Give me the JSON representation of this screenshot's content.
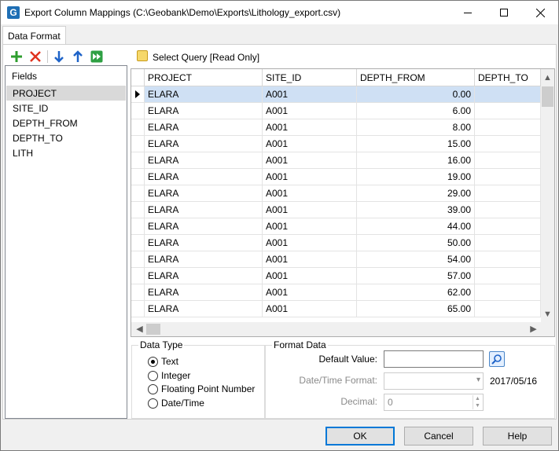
{
  "window": {
    "app_icon_letter": "G",
    "title": "Export Column Mappings (C:\\Geobank\\Demo\\Exports\\Lithology_export.csv)"
  },
  "tabs": [
    {
      "label": "Data Format"
    }
  ],
  "fields_panel": {
    "header": "Fields",
    "items": [
      "PROJECT",
      "SITE_ID",
      "DEPTH_FROM",
      "DEPTH_TO",
      "LITH"
    ],
    "selected": "PROJECT"
  },
  "query": {
    "label": "Select Query [Read Only]"
  },
  "grid": {
    "columns": [
      "PROJECT",
      "SITE_ID",
      "DEPTH_FROM",
      "DEPTH_TO"
    ],
    "rows": [
      [
        "ELARA",
        "A001",
        "0.00",
        ""
      ],
      [
        "ELARA",
        "A001",
        "6.00",
        ""
      ],
      [
        "ELARA",
        "A001",
        "8.00",
        ""
      ],
      [
        "ELARA",
        "A001",
        "15.00",
        ""
      ],
      [
        "ELARA",
        "A001",
        "16.00",
        ""
      ],
      [
        "ELARA",
        "A001",
        "19.00",
        ""
      ],
      [
        "ELARA",
        "A001",
        "29.00",
        ""
      ],
      [
        "ELARA",
        "A001",
        "39.00",
        ""
      ],
      [
        "ELARA",
        "A001",
        "44.00",
        ""
      ],
      [
        "ELARA",
        "A001",
        "50.00",
        ""
      ],
      [
        "ELARA",
        "A001",
        "54.00",
        ""
      ],
      [
        "ELARA",
        "A001",
        "57.00",
        ""
      ],
      [
        "ELARA",
        "A001",
        "62.00",
        ""
      ],
      [
        "ELARA",
        "A001",
        "65.00",
        ""
      ]
    ],
    "selected_row": 0
  },
  "data_type": {
    "legend": "Data Type",
    "options": [
      "Text",
      "Integer",
      "Floating Point Number",
      "Date/Time"
    ],
    "selected": "Text"
  },
  "format_data": {
    "legend": "Format Data",
    "default_value_label": "Default Value:",
    "default_value": "",
    "datetime_format_label": "Date/Time Format:",
    "datetime_format_value": "",
    "datetime_example": "2017/05/16",
    "decimal_label": "Decimal:",
    "decimal_value": "0"
  },
  "buttons": {
    "ok": "OK",
    "cancel": "Cancel",
    "help": "Help"
  },
  "colors": {
    "accent": "#0078d7",
    "selection": "#cfe0f4"
  }
}
